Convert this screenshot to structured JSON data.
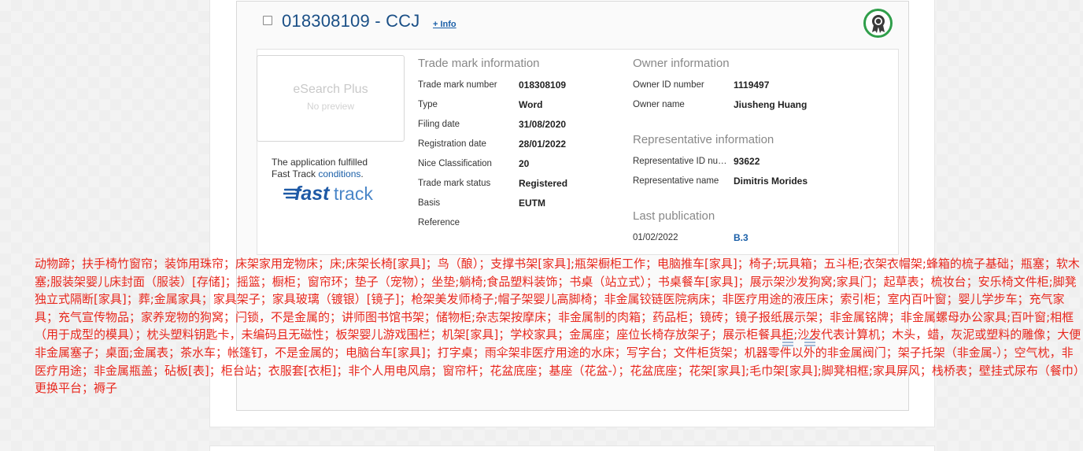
{
  "header": {
    "title": "018308109 - CCJ",
    "info_link": "+ Info",
    "badge_icon": "award-ribbon-icon"
  },
  "preview": {
    "title": "eSearch Plus",
    "subtitle": "No preview"
  },
  "fast_track": {
    "line1": "The application fulfilled",
    "line2_prefix": "Fast Track ",
    "line2_link": "conditions",
    "line2_suffix": ".",
    "logo_fast": "fast",
    "logo_track": "track"
  },
  "trade_mark_info": {
    "title": "Trade mark information",
    "rows": [
      {
        "label": "Trade mark number",
        "value": "018308109"
      },
      {
        "label": "Type",
        "value": "Word"
      },
      {
        "label": "Filing date",
        "value": "31/08/2020"
      },
      {
        "label": "Registration date",
        "value": "28/01/2022"
      },
      {
        "label": "Nice Classification",
        "value": "20"
      },
      {
        "label": "Trade mark status",
        "value": "Registered"
      },
      {
        "label": "Basis",
        "value": "EUTM"
      },
      {
        "label": "Reference",
        "value": ""
      }
    ]
  },
  "owner_info": {
    "title": "Owner information",
    "rows": [
      {
        "label": "Owner ID number",
        "value": "1119497"
      },
      {
        "label": "Owner name",
        "value": "Jiusheng Huang"
      }
    ]
  },
  "representative_info": {
    "title": "Representative information",
    "rows": [
      {
        "label": "Representative ID num...",
        "value": "93622"
      },
      {
        "label": "Representative name",
        "value": "Dimitris Morides"
      }
    ]
  },
  "last_publication": {
    "title": "Last publication",
    "date": "01/02/2022",
    "value": "B.3"
  },
  "goods_overlay": "动物蹄；扶手椅竹窗帘；装饰用珠帘；床架家用宠物床；床;床架长椅[家具]；鸟（酿）；支撑书架[家具];瓶架橱柜工作；电脑推车[家具]；椅子;玩具箱；五斗柜;衣架衣帽架;蜂箱的梳子基础；瓶塞；软木塞;服装架婴儿床封面（服装）[存储]；摇篮；橱柜；窗帘环；垫子（宠物）；坐垫;躺椅;食品塑料装饰；书桌（站立式）；书桌餐车[家具]；展示架沙发狗窝;家具门；起草表；梳妆台；安乐椅文件柜;脚凳独立式隔断[家具]；葬;金属家具；家具架子；家具玻璃（镀银）[镜子]；枪架美发师椅子;帽子架婴儿高脚椅；非金属铰链医院病床；非医疗用途的液压床；索引柜；室内百叶窗；婴儿学步车；充气家具；充气宣传物品；家养宠物的狗窝；闩锁，不是金属的；讲师图书馆书架；储物柜;杂志架按摩床；非金属制的肉箱；药品柜；镜砖；镜子报纸展示架；非金属铭牌；非金属螺母办公家具;百叶窗;相框（用于成型的模具）；枕头塑料钥匙卡，未编码且无磁性；板架婴儿游戏围栏；机架[家具]；学校家具；金属座；座位长椅存放架子；展示柜餐具柜;沙发代表计算机；木头，蜡，灰泥或塑料的雕像；大便非金属塞子；桌面;金属表；茶水车；帐篷钉，不是金属的；电脑台车[家具]；打字桌；雨伞架非医疗用途的水床；写字台；文件柜货架；机器零件以外的非金属阀门；架子托架（非金属-）；空气枕，非医疗用途；非金属瓶盖；砧板[表]；柜台站；衣服套[衣柜]；非个人用电风扇；窗帘杆；花盆底座；基座（花盆-）；花盆底座；花架[家具];毛巾架[家具];脚凳相框;家具屏风；栈桥表；壁挂式尿布（餐巾）更换平台；褥子"
}
